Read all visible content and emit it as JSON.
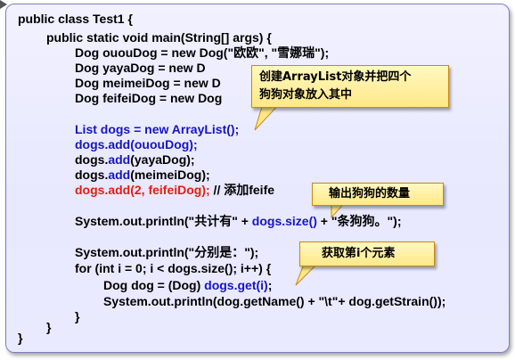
{
  "code": {
    "l1": "public class Test1 {",
    "l2": "public static void main(String[] args) {",
    "l3": "Dog ououDog = new Dog(\"欧欧\", \"雪娜瑞\");",
    "l4": "Dog yayaDog = new D",
    "l5": "Dog meimeiDog = new D",
    "l6": "Dog feifeiDog = new Dog",
    "l7": "List dogs = new ArrayList();",
    "l8": "dogs.add(ououDog);",
    "l9a": "dogs.",
    "l9b": "add",
    "l9c": "(yayaDog);",
    "l10a": "dogs.",
    "l10b": "add",
    "l10c": "(meimeiDog);",
    "l11a": "dogs.add(2, feifeiDog);",
    "l11b": " // 添加feife",
    "l12a": "System.out.println(\"共计有\" + ",
    "l12b": "dogs.size()",
    "l12c": " + \"条狗狗。\");",
    "l13": "System.out.println(\"分别是：\");",
    "l14": "for (int i = 0; i < dogs.size(); i++) {",
    "l15a": "Dog dog = (Dog) ",
    "l15b": "dogs.get(i)",
    "l15c": ";",
    "l16": "System.out.println(dog.getName() + \"\\t\"+ dog.getStrain());",
    "l17": "}",
    "l18": "}",
    "l19": "}"
  },
  "callouts": {
    "create_line1": "创建ArrayList对象并把四个",
    "create_line2": "狗狗对象放入其中",
    "count": "输出狗狗的数量",
    "get": "获取第i个元素"
  },
  "colors": {
    "keyword_blue": "#1414c8",
    "highlight_red": "#e0200a",
    "panel_bg": "#eaeaff",
    "callout_bg": "#ffe888",
    "callout_border": "#c88a10"
  }
}
